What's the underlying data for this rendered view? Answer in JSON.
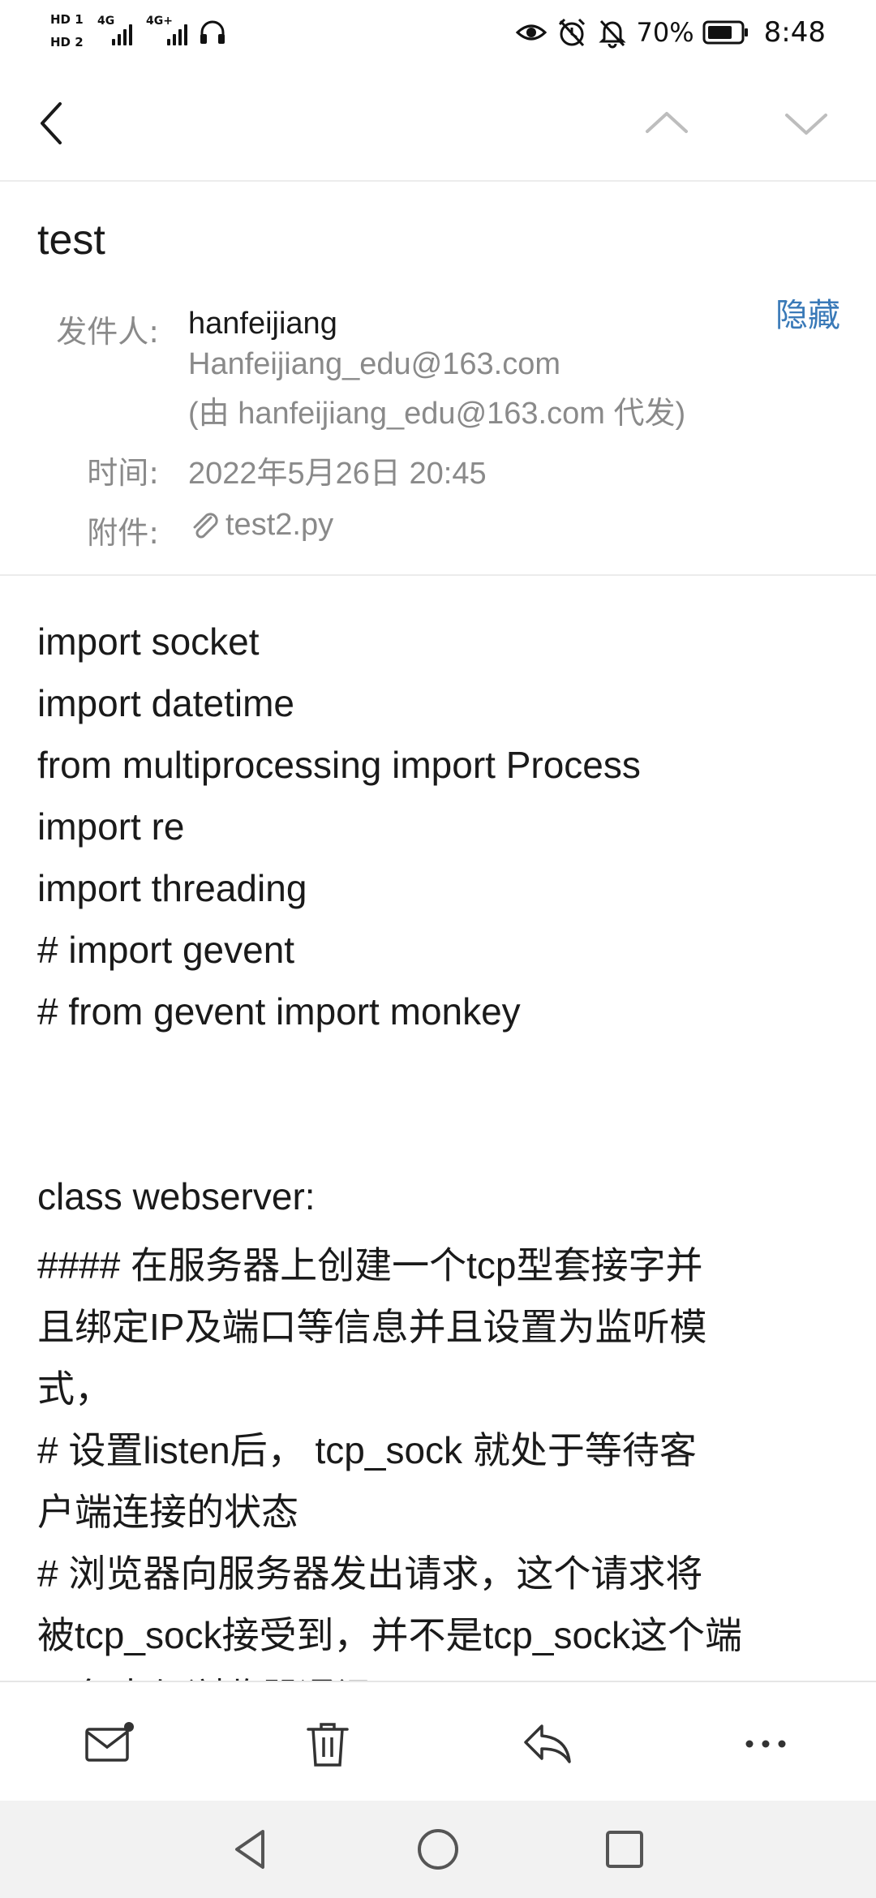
{
  "status_bar": {
    "sim1": "HD 1",
    "sim2": "HD 2",
    "net1": "4G",
    "net2": "4G+",
    "battery": "70%",
    "time": "8:48",
    "icons": [
      "eye-icon",
      "alarm-icon",
      "mute-icon",
      "battery-icon",
      "headphones-icon"
    ]
  },
  "app_bar": {
    "back_icon": "chevron-left-icon",
    "prev_icon": "chevron-up-icon",
    "next_icon": "chevron-down-icon"
  },
  "mail": {
    "subject": "test",
    "hide_label": "隐藏",
    "from_label": "发件人:",
    "sender_name": "hanfeijiang",
    "sender_email": "Hanfeijiang_edu@163.com",
    "sender_proxy": "(由 hanfeijiang_edu@163.com 代发)",
    "time_label": "时间:",
    "time_value": "2022年5月26日 20:45",
    "attach_label": "附件:",
    "attachment": "test2.py"
  },
  "body_lines": [
    "import socket",
    "import datetime",
    "from multiprocessing import Process",
    "import re",
    "import threading",
    "# import gevent",
    "# from gevent import monkey",
    "",
    "",
    "class webserver:",
    "   #### 在服务器上创建一个tcp型套接字并",
    "且绑定IP及端口等信息并且设置为监听模",
    "式，",
    "   # 设置listen后， tcp_sock 就处于等待客",
    "户端连接的状态",
    "   # 浏览器向服务器发出请求，这个请求将",
    "被tcp_sock接受到，并不是tcp_sock这个端",
    "口负责与浏览器通讯"
  ],
  "toolbar": {
    "items": [
      "mark-unread-icon",
      "delete-icon",
      "reply-icon",
      "more-icon"
    ]
  },
  "nav_bar": {
    "items": [
      "nav-back-icon",
      "nav-home-icon",
      "nav-recents-icon"
    ]
  },
  "colors": {
    "accent": "#3a7ab8",
    "secondary_text": "#8a8a8a",
    "primary_text": "#1a1a1a",
    "divider": "#ececec",
    "nav_bg": "#f2f2f2"
  }
}
